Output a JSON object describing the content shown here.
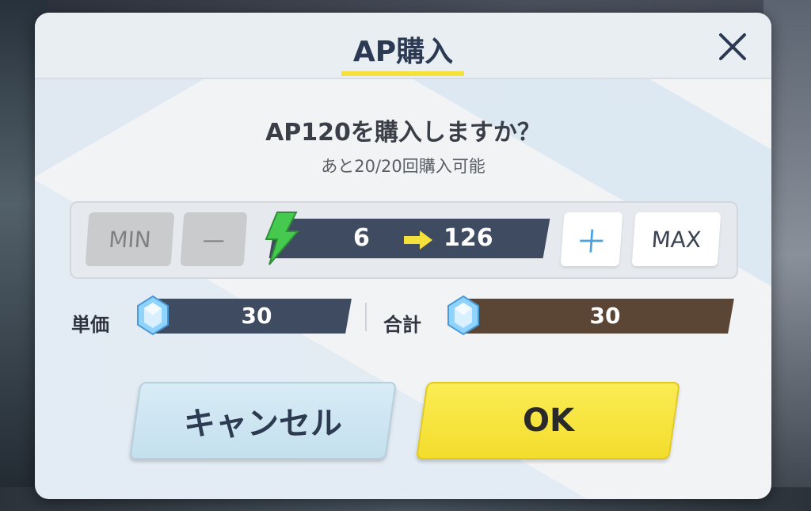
{
  "dialog": {
    "title": "AP購入",
    "question": "AP120を購入しますか？",
    "remaining": "あと20/20回購入可能"
  },
  "quantity": {
    "min_label": "MIN",
    "decrement_label": "—",
    "increment_label": "＋",
    "max_label": "MAX",
    "ap_from": "6",
    "ap_to": "126"
  },
  "price": {
    "unit_label": "単価",
    "unit_value": "30",
    "total_label": "合計",
    "total_value": "30"
  },
  "buttons": {
    "cancel_label": "キャンセル",
    "ok_label": "OK"
  },
  "colors": {
    "accent_yellow": "#f4e23a",
    "bar_navy": "#3f4b60",
    "total_brown": "#5b4535",
    "ap_green": "#3fc24a"
  },
  "icons": [
    "close-icon",
    "ap-lightning-icon",
    "arrow-right-icon",
    "gem-icon"
  ]
}
